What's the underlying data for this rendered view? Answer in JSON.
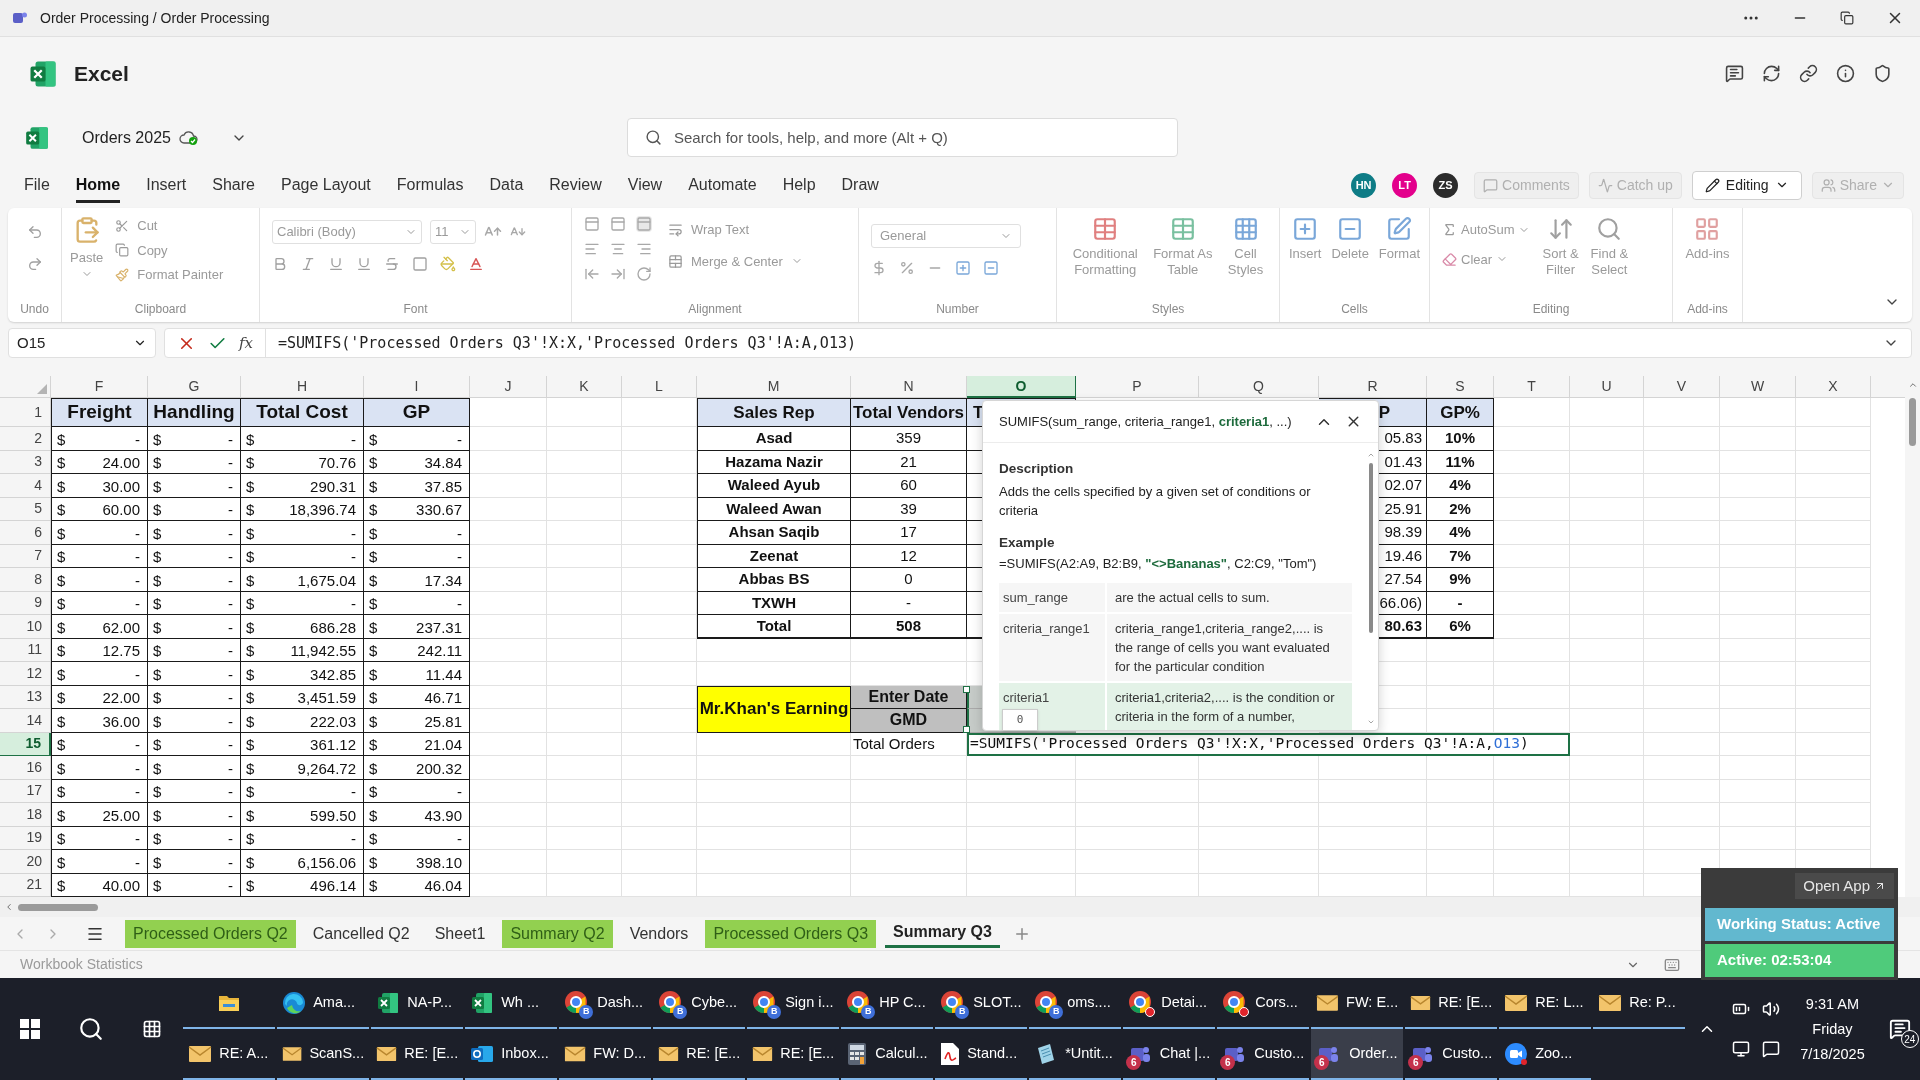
{
  "titlebar": {
    "title": "Order Processing / Order Processing"
  },
  "app": {
    "name": "Excel"
  },
  "document": {
    "name": "Orders 2025"
  },
  "search": {
    "placeholder": "Search for tools, help, and more (Alt + Q)"
  },
  "menu_tabs": [
    {
      "label": "File",
      "selected": false
    },
    {
      "label": "Home",
      "selected": true
    },
    {
      "label": "Insert",
      "selected": false
    },
    {
      "label": "Share",
      "selected": false
    },
    {
      "label": "Page Layout",
      "selected": false
    },
    {
      "label": "Formulas",
      "selected": false
    },
    {
      "label": "Data",
      "selected": false
    },
    {
      "label": "Review",
      "selected": false
    },
    {
      "label": "View",
      "selected": false
    },
    {
      "label": "Automate",
      "selected": false
    },
    {
      "label": "Help",
      "selected": false
    },
    {
      "label": "Draw",
      "selected": false
    }
  ],
  "avatars": [
    {
      "initials": "HN",
      "color": "#0e7c86"
    },
    {
      "initials": "LT",
      "color": "#e3008c"
    },
    {
      "initials": "ZS",
      "color": "#2b2b2b"
    }
  ],
  "header_buttons": [
    {
      "kind": "comments",
      "label": "Comments",
      "disabled": true
    },
    {
      "kind": "catchup",
      "label": "Catch up",
      "disabled": true
    },
    {
      "kind": "editing",
      "label": "Editing",
      "disabled": false
    },
    {
      "kind": "share",
      "label": "Share",
      "disabled": true
    }
  ],
  "ribbon": {
    "groups": [
      {
        "kind": "undo",
        "label": "Undo"
      },
      {
        "kind": "clipboard",
        "label": "Clipboard",
        "paste": "Paste",
        "cut": "Cut",
        "copy": "Copy",
        "format_painter": "Format Painter"
      },
      {
        "kind": "font",
        "label": "Font",
        "font_name": "Calibri (Body)",
        "font_size": "11"
      },
      {
        "kind": "alignment",
        "label": "Alignment",
        "wrap_text": "Wrap Text",
        "merge": "Merge & Center"
      },
      {
        "kind": "number",
        "label": "Number",
        "format": "General"
      },
      {
        "kind": "styles",
        "label": "Styles",
        "buttons": [
          [
            "Conditional",
            "Formatting"
          ],
          [
            "Format As",
            "Table"
          ],
          [
            "Cell",
            "Styles"
          ]
        ]
      },
      {
        "kind": "cells",
        "label": "Cells",
        "buttons": [
          "Insert",
          "Delete",
          "Format"
        ]
      },
      {
        "kind": "editing",
        "label": "Editing",
        "autosum": "AutoSum",
        "clear": "Clear",
        "buttons": [
          [
            "Sort &",
            "Filter"
          ],
          [
            "Find &",
            "Select"
          ]
        ]
      },
      {
        "kind": "addins",
        "label": "Add-ins",
        "button": "Add-ins"
      }
    ]
  },
  "formula_bar": {
    "name_box": "O15",
    "function_label": "fx",
    "formula": "=SUMIFS('Processed Orders Q3'!X:X,'Processed Orders Q3'!A:A,O13)"
  },
  "sheet": {
    "columns": [
      {
        "letter": "F",
        "selected": false
      },
      {
        "letter": "G",
        "selected": false
      },
      {
        "letter": "H",
        "selected": false
      },
      {
        "letter": "I",
        "selected": false
      },
      {
        "letter": "J",
        "selected": false
      },
      {
        "letter": "K",
        "selected": false
      },
      {
        "letter": "L",
        "selected": false
      },
      {
        "letter": "M",
        "selected": false
      },
      {
        "letter": "N",
        "selected": false
      },
      {
        "letter": "O",
        "selected": true
      },
      {
        "letter": "P",
        "selected": false
      },
      {
        "letter": "Q",
        "selected": false
      },
      {
        "letter": "R",
        "selected": false
      },
      {
        "letter": "S",
        "selected": false
      },
      {
        "letter": "T",
        "selected": false
      },
      {
        "letter": "U",
        "selected": false
      },
      {
        "letter": "V",
        "selected": false
      },
      {
        "letter": "W",
        "selected": false
      },
      {
        "letter": "X",
        "selected": false
      }
    ],
    "row_numbers": [
      {
        "label": "1",
        "selected": false
      },
      {
        "label": "2",
        "selected": false
      },
      {
        "label": "3",
        "selected": false
      },
      {
        "label": "4",
        "selected": false
      },
      {
        "label": "5",
        "selected": false
      },
      {
        "label": "6",
        "selected": false
      },
      {
        "label": "7",
        "selected": false
      },
      {
        "label": "8",
        "selected": false
      },
      {
        "label": "9",
        "selected": false
      },
      {
        "label": "10",
        "selected": false
      },
      {
        "label": "11",
        "selected": false
      },
      {
        "label": "12",
        "selected": false
      },
      {
        "label": "13",
        "selected": false
      },
      {
        "label": "14",
        "selected": false
      },
      {
        "label": "15",
        "selected": true
      },
      {
        "label": "16",
        "selected": false
      },
      {
        "label": "17",
        "selected": false
      },
      {
        "label": "18",
        "selected": false
      },
      {
        "label": "19",
        "selected": false
      },
      {
        "label": "20",
        "selected": false
      },
      {
        "label": "21",
        "selected": false
      }
    ],
    "cost_table": {
      "headers": [
        "Freight",
        "Handling",
        "Total Cost",
        "GP"
      ],
      "rows": [
        [
          [
            "$",
            "-"
          ],
          [
            "$",
            "-"
          ],
          [
            "$",
            "-"
          ],
          [
            "$",
            "-"
          ]
        ],
        [
          [
            "$",
            "24.00"
          ],
          [
            "$",
            "-"
          ],
          [
            "$",
            "70.76"
          ],
          [
            "$",
            "34.84"
          ]
        ],
        [
          [
            "$",
            "30.00"
          ],
          [
            "$",
            "-"
          ],
          [
            "$",
            "290.31"
          ],
          [
            "$",
            "37.85"
          ]
        ],
        [
          [
            "$",
            "60.00"
          ],
          [
            "$",
            "-"
          ],
          [
            "$",
            "18,396.74"
          ],
          [
            "$",
            "330.67"
          ]
        ],
        [
          [
            "$",
            "-"
          ],
          [
            "$",
            "-"
          ],
          [
            "$",
            "-"
          ],
          [
            "$",
            "-"
          ]
        ],
        [
          [
            "$",
            "-"
          ],
          [
            "$",
            "-"
          ],
          [
            "$",
            "-"
          ],
          [
            "$",
            "-"
          ]
        ],
        [
          [
            "$",
            "-"
          ],
          [
            "$",
            "-"
          ],
          [
            "$",
            "1,675.04"
          ],
          [
            "$",
            "17.34"
          ]
        ],
        [
          [
            "$",
            "-"
          ],
          [
            "$",
            "-"
          ],
          [
            "$",
            "-"
          ],
          [
            "$",
            "-"
          ]
        ],
        [
          [
            "$",
            "62.00"
          ],
          [
            "$",
            "-"
          ],
          [
            "$",
            "686.28"
          ],
          [
            "$",
            "237.31"
          ]
        ],
        [
          [
            "$",
            "12.75"
          ],
          [
            "$",
            "-"
          ],
          [
            "$",
            "11,942.55"
          ],
          [
            "$",
            "242.11"
          ]
        ],
        [
          [
            "$",
            "-"
          ],
          [
            "$",
            "-"
          ],
          [
            "$",
            "342.85"
          ],
          [
            "$",
            "11.44"
          ]
        ],
        [
          [
            "$",
            "22.00"
          ],
          [
            "$",
            "-"
          ],
          [
            "$",
            "3,451.59"
          ],
          [
            "$",
            "46.71"
          ]
        ],
        [
          [
            "$",
            "36.00"
          ],
          [
            "$",
            "-"
          ],
          [
            "$",
            "222.03"
          ],
          [
            "$",
            "25.81"
          ]
        ],
        [
          [
            "$",
            "-"
          ],
          [
            "$",
            "-"
          ],
          [
            "$",
            "361.12"
          ],
          [
            "$",
            "21.04"
          ]
        ],
        [
          [
            "$",
            "-"
          ],
          [
            "$",
            "-"
          ],
          [
            "$",
            "9,264.72"
          ],
          [
            "$",
            "200.32"
          ]
        ],
        [
          [
            "$",
            "-"
          ],
          [
            "$",
            "-"
          ],
          [
            "$",
            "-"
          ],
          [
            "$",
            "-"
          ]
        ],
        [
          [
            "$",
            "25.00"
          ],
          [
            "$",
            "-"
          ],
          [
            "$",
            "599.50"
          ],
          [
            "$",
            "43.90"
          ]
        ],
        [
          [
            "$",
            "-"
          ],
          [
            "$",
            "-"
          ],
          [
            "$",
            "-"
          ],
          [
            "$",
            "-"
          ]
        ],
        [
          [
            "$",
            "-"
          ],
          [
            "$",
            "-"
          ],
          [
            "$",
            "6,156.06"
          ],
          [
            "$",
            "398.10"
          ]
        ],
        [
          [
            "$",
            "40.00"
          ],
          [
            "$",
            "-"
          ],
          [
            "$",
            "496.14"
          ],
          [
            "$",
            "46.04"
          ]
        ]
      ]
    },
    "rep_table": {
      "headers": {
        "rep": "Sales Rep",
        "vendors": "Total Vendors",
        "column_o": "T",
        "column_r": "P",
        "gp_pct": "GP%"
      },
      "rows": [
        {
          "kind": "rep",
          "rep": "Asad",
          "vendors": "359",
          "column_r": "05.83",
          "gp_pct": "10%"
        },
        {
          "kind": "rep",
          "rep": "Hazama Nazir",
          "vendors": "21",
          "column_r": "01.43",
          "gp_pct": "11%"
        },
        {
          "kind": "rep",
          "rep": "Waleed Ayub",
          "vendors": "60",
          "column_r": "02.07",
          "gp_pct": "4%"
        },
        {
          "kind": "rep",
          "rep": "Waleed Awan",
          "vendors": "39",
          "column_r": "25.91",
          "gp_pct": "2%"
        },
        {
          "kind": "rep",
          "rep": "Ahsan Saqib",
          "vendors": "17",
          "column_r": "98.39",
          "gp_pct": "4%"
        },
        {
          "kind": "rep",
          "rep": "Zeenat",
          "vendors": "12",
          "column_r": "19.46",
          "gp_pct": "7%"
        },
        {
          "kind": "rep",
          "rep": "Abbas BS",
          "vendors": "0",
          "column_r": "27.54",
          "gp_pct": "9%"
        },
        {
          "kind": "rep",
          "rep": "TXWH",
          "vendors": "-",
          "column_r": "66.06)",
          "gp_pct": "-"
        },
        {
          "kind": "total",
          "rep": "Total",
          "vendors": "508",
          "column_r": "80.63",
          "gp_pct": "6%"
        }
      ]
    },
    "earnings": {
      "title": "Mr.Khan's Earning",
      "labels": [
        "Enter Date",
        "GMD"
      ],
      "total_orders_label": "Total Orders",
      "formula_parts": [
        {
          "kind": "text",
          "text": "=SUMIFS('Processed Orders Q3'!X:X,'Processed Orders Q3'!A:A,"
        },
        {
          "kind": "reference",
          "text": "O13"
        },
        {
          "kind": "text",
          "text": ")"
        }
      ],
      "value_hint": "0"
    },
    "function_tooltip": {
      "signature": "SUMIFS(sum_range, criteria_range1, **criteria1**, ...)",
      "description_heading": "Description",
      "description": "Adds the cells specified by a given set of conditions or criteria",
      "example_heading": "Example",
      "example": "=SUMIFS(A2:A9, B2:B9, **\"<>Bananas\"**, C2:C9, \"Tom\")",
      "arguments": [
        {
          "name": "sum_range",
          "text": "are the actual cells to sum.",
          "selected": false
        },
        {
          "name": "criteria_range1",
          "text": "criteria_range1,criteria_range2,.... is the range of cells you want evaluated for the particular condition",
          "selected": false
        },
        {
          "name": "criteria1",
          "text": "criteria1,criteria2,.... is the condition or criteria in the form of a number,",
          "selected": true
        }
      ]
    }
  },
  "sheet_tabs": [
    {
      "label": "Processed Orders Q2",
      "color": "#92d050",
      "selected": false
    },
    {
      "label": "Cancelled Q2",
      "selected": false
    },
    {
      "label": "Sheet1",
      "selected": false
    },
    {
      "label": "Summary Q2",
      "color": "#92d050",
      "selected": false
    },
    {
      "label": "Vendors",
      "selected": false
    },
    {
      "label": "Processed Orders Q3",
      "color": "#92d050",
      "selected": false
    },
    {
      "label": "Summary Q3",
      "selected": true
    }
  ],
  "status_bar": {
    "text": "Workbook Statistics"
  },
  "status_widget": {
    "open_app": "Open App",
    "status": "Working Status: Active",
    "timer": "Active: 02:53:04"
  },
  "taskbar": {
    "rows": [
      [
        {
          "kind": "explorer",
          "selected": false
        },
        {
          "kind": "edge",
          "label": "Ama...",
          "selected": false
        },
        {
          "kind": "excel",
          "label": "NA-P...",
          "selected": false
        },
        {
          "kind": "excel",
          "label": "Wh ...",
          "selected": false
        },
        {
          "kind": "chrome",
          "label": "Dash...",
          "badge": "B",
          "selected": false
        },
        {
          "kind": "chrome",
          "label": "Cybe...",
          "badge": "B",
          "selected": false
        },
        {
          "kind": "chrome",
          "label": "Sign i...",
          "badge": "B",
          "selected": false
        },
        {
          "kind": "chrome",
          "label": "HP C...",
          "badge": "B",
          "selected": false
        },
        {
          "kind": "chrome",
          "label": "SLOT...",
          "badge": "B",
          "selected": false
        },
        {
          "kind": "chrome",
          "label": "oms....",
          "badge": "B",
          "selected": false
        },
        {
          "kind": "chrome",
          "label": "Detai...",
          "alert": true,
          "selected": false
        },
        {
          "kind": "chrome",
          "label": "Cors...",
          "alert": true,
          "selected": false
        },
        {
          "kind": "mail",
          "label": "FW: E...",
          "selected": false
        },
        {
          "kind": "mail",
          "label": "RE: [E...",
          "selected": false
        },
        {
          "kind": "mail",
          "label": "RE: L...",
          "selected": false
        },
        {
          "kind": "mail",
          "label": "Re: P...",
          "selected": false
        }
      ],
      [
        {
          "kind": "mail",
          "label": "RE: A...",
          "selected": false
        },
        {
          "kind": "mail",
          "label": "ScanS...",
          "selected": false
        },
        {
          "kind": "mail",
          "label": "RE: [E...",
          "selected": false
        },
        {
          "kind": "outlook",
          "label": "Inbox...",
          "selected": false
        },
        {
          "kind": "mail",
          "label": "FW: D...",
          "selected": false
        },
        {
          "kind": "mail",
          "label": "RE: [E...",
          "selected": false
        },
        {
          "kind": "mail",
          "label": "RE: [E...",
          "selected": false
        },
        {
          "kind": "calculator",
          "label": "Calcul...",
          "selected": false
        },
        {
          "kind": "pdf",
          "label": "Stand...",
          "selected": false
        },
        {
          "kind": "notepad",
          "label": "*Untit...",
          "selected": false
        },
        {
          "kind": "teams",
          "label": "Chat |...",
          "badge": "6",
          "selected": false
        },
        {
          "kind": "teams",
          "label": "Custo...",
          "badge": "6",
          "selected": false
        },
        {
          "kind": "teams",
          "label": "Order...",
          "badge": "6",
          "selected": true
        },
        {
          "kind": "teams",
          "label": "Custo...",
          "badge": "6",
          "selected": false
        },
        {
          "kind": "zoom",
          "label": "Zoo...",
          "selected": false
        }
      ]
    ],
    "tray": {
      "time": "9:31 AM",
      "day": "Friday",
      "date": "7/18/2025",
      "notifications": "24"
    }
  }
}
